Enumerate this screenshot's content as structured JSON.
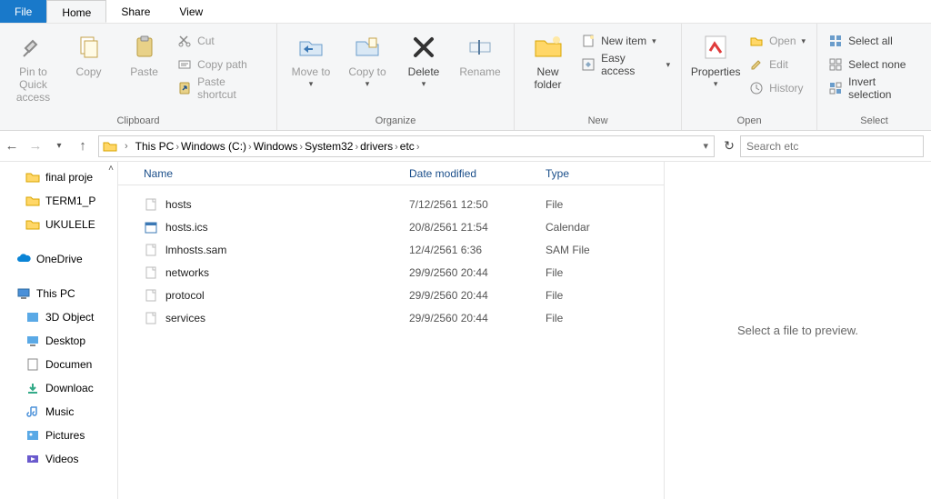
{
  "tabs": {
    "file": "File",
    "home": "Home",
    "share": "Share",
    "view": "View"
  },
  "ribbon": {
    "clipboard": {
      "label": "Clipboard",
      "pin": "Pin to Quick access",
      "copy": "Copy",
      "paste": "Paste",
      "cut": "Cut",
      "copy_path": "Copy path",
      "paste_shortcut": "Paste shortcut"
    },
    "organize": {
      "label": "Organize",
      "move_to": "Move to",
      "copy_to": "Copy to",
      "delete": "Delete",
      "rename": "Rename"
    },
    "new": {
      "label": "New",
      "new_folder": "New folder",
      "new_item": "New item",
      "easy_access": "Easy access"
    },
    "open": {
      "label": "Open",
      "properties": "Properties",
      "open": "Open",
      "edit": "Edit",
      "history": "History"
    },
    "select": {
      "label": "Select",
      "select_all": "Select all",
      "select_none": "Select none",
      "invert": "Invert selection"
    }
  },
  "breadcrumbs": [
    "This PC",
    "Windows (C:)",
    "Windows",
    "System32",
    "drivers",
    "etc"
  ],
  "search": {
    "placeholder": "Search etc"
  },
  "navpane": {
    "quick": [
      "final proje",
      "TERM1_P",
      "UKULELE"
    ],
    "onedrive": "OneDrive",
    "thispc": "This PC",
    "thispc_children": [
      "3D Object",
      "Desktop",
      "Documen",
      "Downloac",
      "Music",
      "Pictures",
      "Videos"
    ]
  },
  "columns": {
    "name": "Name",
    "date": "Date modified",
    "type": "Type"
  },
  "files": [
    {
      "name": "hosts",
      "date": "7/12/2561 12:50",
      "type": "File",
      "icon": "blank"
    },
    {
      "name": "hosts.ics",
      "date": "20/8/2561 21:54",
      "type": "Calendar",
      "icon": "cal"
    },
    {
      "name": "lmhosts.sam",
      "date": "12/4/2561 6:36",
      "type": "SAM File",
      "icon": "blank"
    },
    {
      "name": "networks",
      "date": "29/9/2560 20:44",
      "type": "File",
      "icon": "blank"
    },
    {
      "name": "protocol",
      "date": "29/9/2560 20:44",
      "type": "File",
      "icon": "blank"
    },
    {
      "name": "services",
      "date": "29/9/2560 20:44",
      "type": "File",
      "icon": "blank"
    }
  ],
  "preview_text": "Select a file to preview."
}
